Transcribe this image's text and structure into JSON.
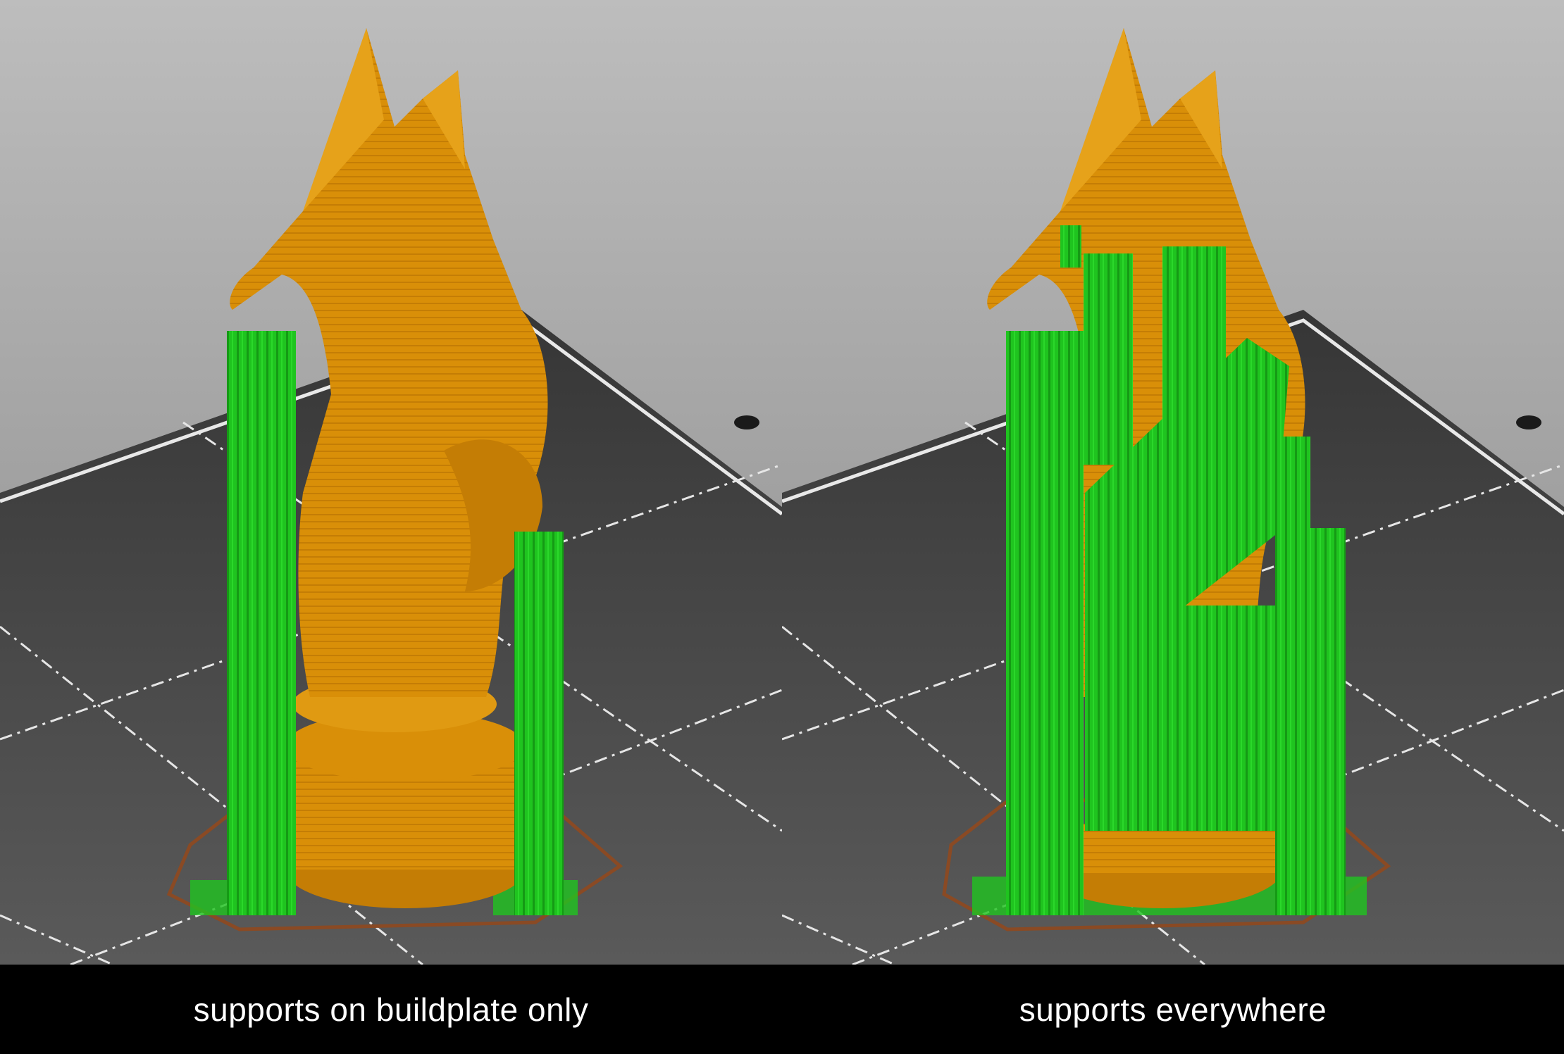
{
  "captions": {
    "left": "supports on buildplate only",
    "right": "supports everywhere"
  },
  "colors": {
    "background_top": "#bdbdbd",
    "background_bottom": "#7e7e7e",
    "buildplate": "#3d3d3d",
    "model": "#d98f08",
    "support": "#1fc41f",
    "skirt": "#8a4a24"
  }
}
